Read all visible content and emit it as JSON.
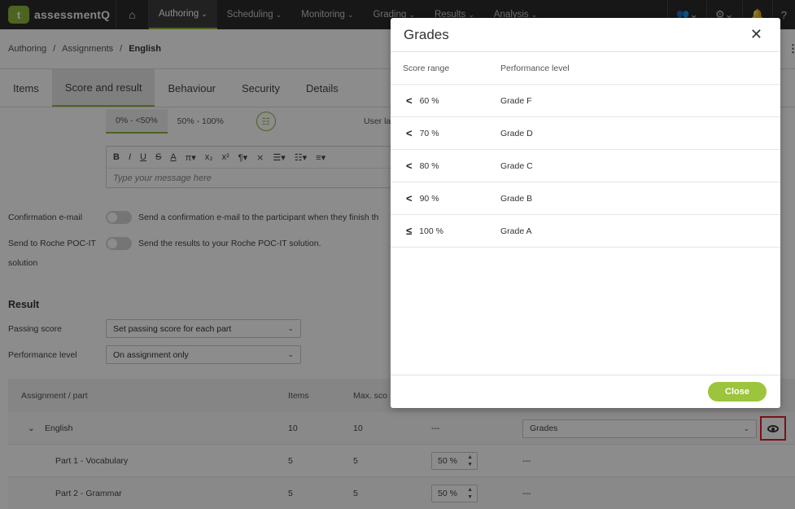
{
  "app": {
    "logo_letter": "t",
    "logo_text": "assessmentQ",
    "nav": [
      {
        "label": "Authoring"
      },
      {
        "label": "Scheduling"
      },
      {
        "label": "Monitoring"
      },
      {
        "label": "Grading"
      },
      {
        "label": "Results"
      },
      {
        "label": "Analysis"
      }
    ],
    "nav_icons": [
      "users-icon",
      "settings-gear-icon",
      "bell-icon",
      "help-icon"
    ]
  },
  "breadcrumb": [
    "Authoring",
    "Assignments",
    "English"
  ],
  "tabs": [
    "Items",
    "Score and result",
    "Behaviour",
    "Security",
    "Details"
  ],
  "score_tabs": {
    "ranges": [
      "0% - <50%",
      "50% - 100%"
    ],
    "user_language_label": "User la"
  },
  "editor": {
    "toolbar": [
      "B",
      "I",
      "U",
      "S",
      "A",
      "π▾",
      "x₂",
      "x²",
      "¶▾",
      "⨯",
      "☰▾",
      "☷▾",
      "≡▾"
    ],
    "placeholder": "Type your message here"
  },
  "settings": {
    "confirmation_label": "Confirmation e-mail",
    "confirmation_text": "Send a confirmation e-mail to the participant when they finish th",
    "send_label_1": "Send to Roche POC-IT",
    "send_label_2": "solution",
    "send_text": "Send the results to your Roche POC-IT solution."
  },
  "result": {
    "title": "Result",
    "passing_label": "Passing score",
    "passing_value": "Set passing score for each part",
    "performance_label": "Performance level",
    "performance_value": "On assignment only"
  },
  "table": {
    "headers": [
      "Assignment / part",
      "Items",
      "Max. sco"
    ],
    "rows": [
      {
        "name": "English",
        "items": "10",
        "max": "10",
        "passing": "---",
        "perf": "Grades",
        "expandable": true
      },
      {
        "name": "Part 1 - Vocabulary",
        "items": "5",
        "max": "5",
        "passing": "50 %",
        "perf": "---"
      },
      {
        "name": "Part 2 - Grammar",
        "items": "5",
        "max": "5",
        "passing": "50 %",
        "perf": "---"
      }
    ]
  },
  "modal": {
    "title": "Grades",
    "col_score": "Score range",
    "col_level": "Performance level",
    "rows": [
      {
        "op": "<",
        "value": "60 %",
        "level": "Grade F"
      },
      {
        "op": "<",
        "value": "70 %",
        "level": "Grade D"
      },
      {
        "op": "<",
        "value": "80 %",
        "level": "Grade C"
      },
      {
        "op": "<",
        "value": "90 %",
        "level": "Grade B"
      },
      {
        "op": "≤",
        "value": "100 %",
        "level": "Grade A"
      }
    ],
    "close_label": "Close"
  },
  "colors": {
    "accent": "#8cb43c",
    "nav_bg": "#2b2b2b",
    "highlight": "#e0202a"
  }
}
